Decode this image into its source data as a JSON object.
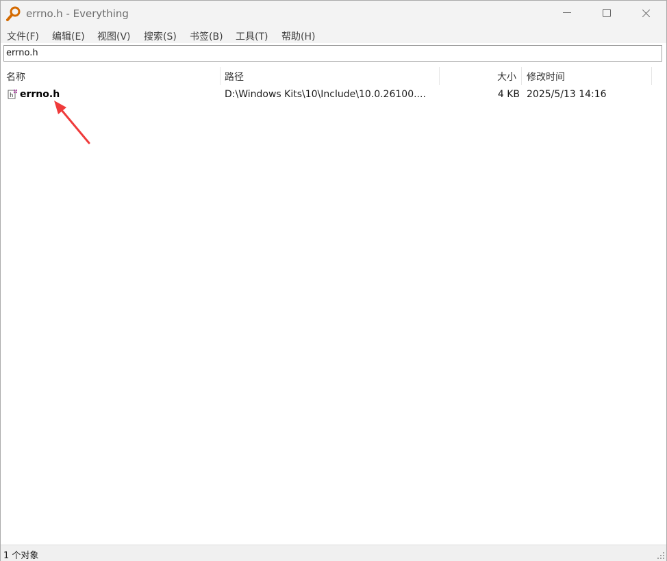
{
  "window": {
    "title": "errno.h - Everything"
  },
  "menu": [
    "文件(F)",
    "编辑(E)",
    "视图(V)",
    "搜索(S)",
    "书签(B)",
    "工具(T)",
    "帮助(H)"
  ],
  "search": {
    "value": "errno.h"
  },
  "columns": {
    "name": "名称",
    "path": "路径",
    "size": "大小",
    "modified": "修改时间"
  },
  "results": [
    {
      "name": "errno.h",
      "path": "D:\\Windows Kits\\10\\Include\\10.0.26100....",
      "size": "4 KB",
      "modified": "2025/5/13 14:16"
    }
  ],
  "status": {
    "text": "1 个对象"
  },
  "icons": {
    "app": "magnifier-icon",
    "file": "header-file-icon"
  },
  "colors": {
    "annotation_arrow": "#ef3b3b",
    "app_icon": "#d46a00"
  }
}
